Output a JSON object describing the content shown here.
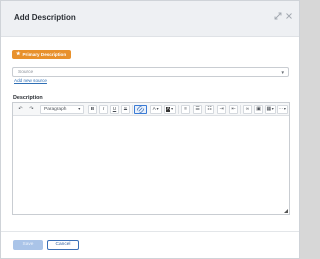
{
  "modal": {
    "title": "Add Description",
    "expand_icon": "expand-icon",
    "close_icon": "close-icon"
  },
  "badge": {
    "label": "Primary Description",
    "icon": "star-icon",
    "color": "#e8912c"
  },
  "source": {
    "placeholder": "Source",
    "add_link": "Add new source"
  },
  "description": {
    "label": "Description",
    "value": ""
  },
  "toolbar": {
    "undo_icon": "undo-icon",
    "redo_icon": "redo-icon",
    "block_format": "Paragraph",
    "bold": "B",
    "italic": "I",
    "underline": "U",
    "strike": "S",
    "text_color_glyph": "A",
    "highlight_glyph": "A"
  },
  "footer": {
    "save_label": "Save",
    "cancel_label": "Cancel"
  },
  "colors": {
    "accent": "#3a6fb7",
    "link": "#2f6fb5",
    "badge": "#e8912c"
  }
}
